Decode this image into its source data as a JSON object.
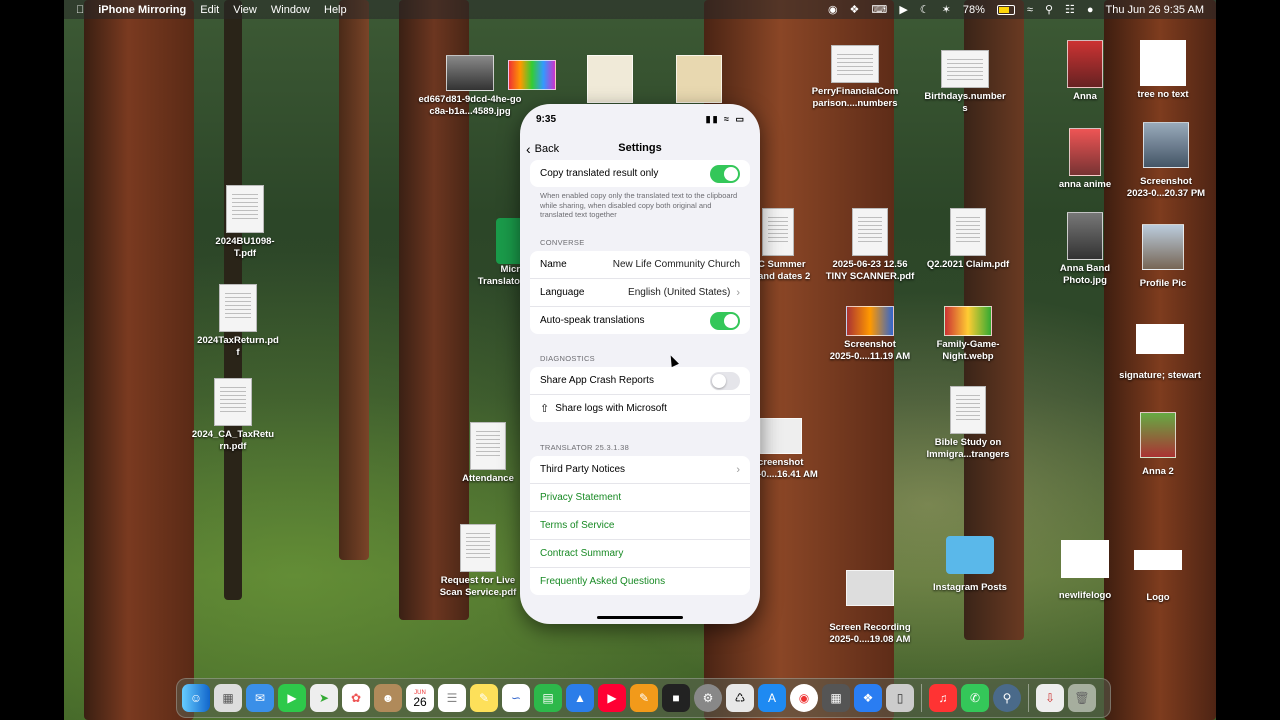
{
  "menubar": {
    "app_name": "iPhone Mirroring",
    "menus": [
      "Edit",
      "View",
      "Window",
      "Help"
    ],
    "battery": "78%",
    "datetime": "Thu Jun 26  9:35 AM"
  },
  "desktop_icons": [
    {
      "label": "ed667d81-9dcd-4he-go\nc8a-b1a...4589.jpg"
    },
    {
      "label": "2024BU1098-\nT.pdf"
    },
    {
      "label": "2024TaxReturn.pd\nf"
    },
    {
      "label": "2024_CA_TaxRetu\nrn.pdf"
    },
    {
      "label": "Attendance"
    },
    {
      "label": "Request for Live\nScan Service.pdf"
    },
    {
      "label": "PerryFinancialCom\nparison....numbers"
    },
    {
      "label": "Birthdays.number\ns"
    },
    {
      "label": "C Summer\nand dates 2"
    },
    {
      "label": "2025-06-23 12.56\nTINY SCANNER.pdf"
    },
    {
      "label": "Q2.2021 Claim.pdf"
    },
    {
      "label": "Screenshot\n2025-0....11.19 AM"
    },
    {
      "label": "Family-Game-\nNight.webp"
    },
    {
      "label": "creenshot\n-0....16.41 AM"
    },
    {
      "label": "Bible Study on\nImmigra...trangers"
    },
    {
      "label": "Instagram Posts"
    },
    {
      "label": "Screen Recording\n2025-0....19.08 AM"
    },
    {
      "label": "Anna"
    },
    {
      "label": "anna anime"
    },
    {
      "label": "Anna Band\nPhoto.jpg"
    },
    {
      "label": "tree no text"
    },
    {
      "label": "Screenshot\n2023-0...20.37 PM"
    },
    {
      "label": "Profile Pic"
    },
    {
      "label": "signature; stewart"
    },
    {
      "label": "Anna 2"
    },
    {
      "label": "newlifelogo"
    },
    {
      "label": "Logo"
    },
    {
      "label": "Micr\nTranslato"
    }
  ],
  "phone": {
    "time": "9:35",
    "back_label": "Back",
    "title": "Settings",
    "copy_translated_label": "Copy translated result only",
    "copy_translated_on": true,
    "copy_note": "When enabled copy only the translated text to the clipboard while sharing, when disabled copy both original and translated text together",
    "converse_header": "CONVERSE",
    "name_label": "Name",
    "name_value": "New Life Community Church",
    "language_label": "Language",
    "language_value": "English (United States)",
    "autospeak_label": "Auto-speak translations",
    "autospeak_on": true,
    "diagnostics_header": "DIAGNOSTICS",
    "crash_reports_label": "Share App Crash Reports",
    "crash_reports_on": false,
    "share_logs_label": "Share logs with Microsoft",
    "version_header": "TRANSLATOR 25.3.1.38",
    "third_party_label": "Third Party Notices",
    "privacy_label": "Privacy Statement",
    "terms_label": "Terms of Service",
    "contract_label": "Contract Summary",
    "faq_label": "Frequently Asked Questions"
  },
  "dock": {
    "calendar_month": "JUN",
    "calendar_day": "26"
  },
  "colors": {
    "toggle_on": "#34c759",
    "link_green": "#188a24"
  }
}
